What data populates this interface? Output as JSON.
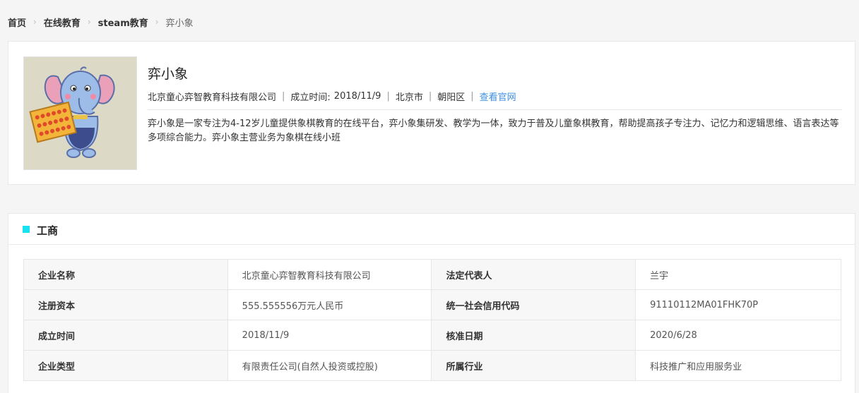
{
  "breadcrumb": {
    "items": [
      "首页",
      "在线教育",
      "steam教育"
    ],
    "current": "弈小象"
  },
  "company": {
    "name": "弈小象",
    "legal_name": "北京童心弈智教育科技有限公司",
    "founded_label": "成立时间:",
    "founded": "2018/11/9",
    "city": "北京市",
    "district": "朝阳区",
    "website_link": "查看官网",
    "separator": "|",
    "description": "弈小象是一家专注为4-12岁儿童提供象棋教育的在线平台，弈小象集研发、教学为一体，致力于普及儿童象棋教育，帮助提高孩子专注力、记忆力和逻辑思维、语言表达等多项综合能力。弈小象主营业务为象棋在线小班",
    "logo_icon": "elephant-mascot-icon"
  },
  "business": {
    "section_title": "工商",
    "accent_color": "#19e2f0",
    "rows": [
      [
        "企业名称",
        "北京童心弈智教育科技有限公司",
        "法定代表人",
        "兰宇"
      ],
      [
        "注册资本",
        "555.555556万元人民币",
        "统一社会信用代码",
        "91110112MA01FHK70P"
      ],
      [
        "成立时间",
        "2018/11/9",
        "核准日期",
        "2020/6/28"
      ],
      [
        "企业类型",
        "有限责任公司(自然人投资或控股)",
        "所属行业",
        "科技推广和应用服务业"
      ]
    ]
  }
}
